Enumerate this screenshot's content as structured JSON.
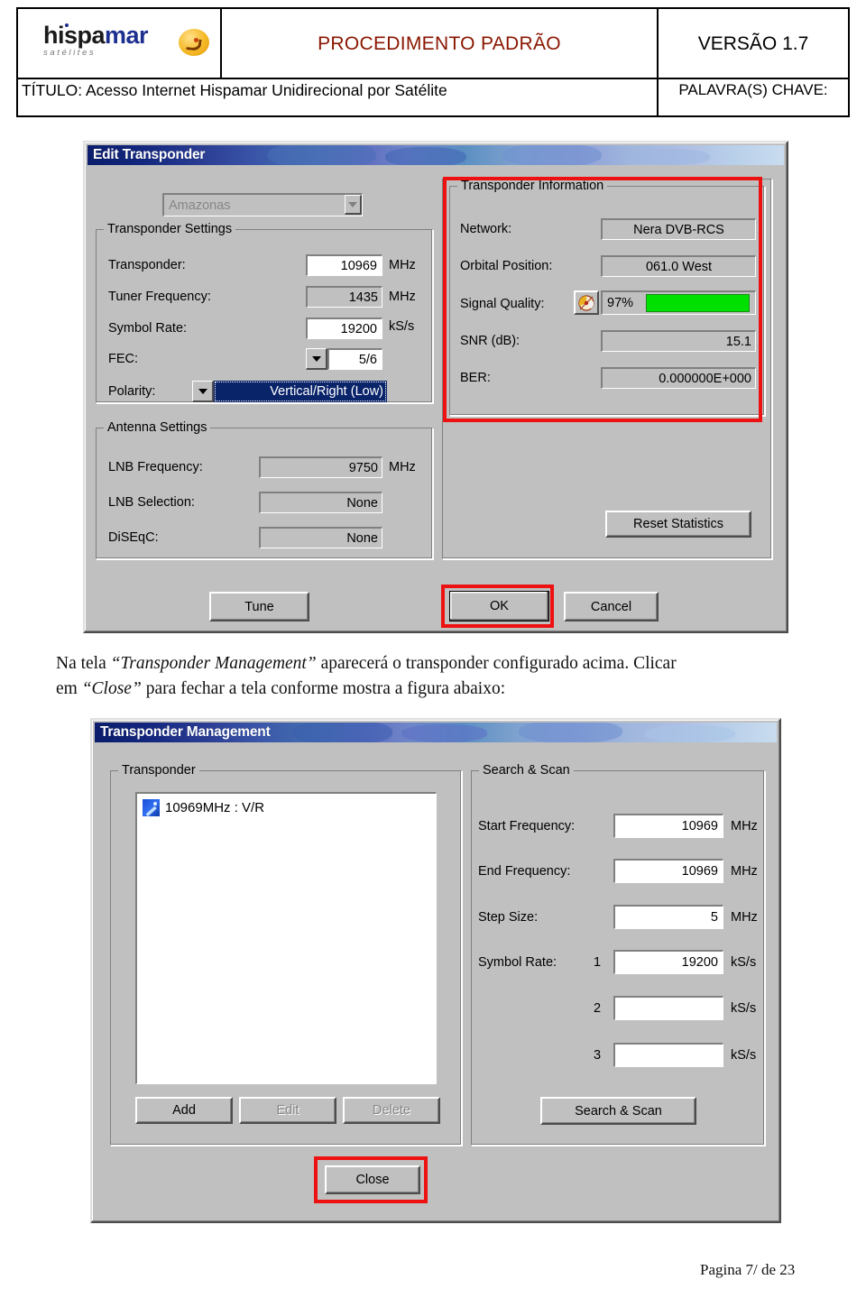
{
  "header": {
    "logo": {
      "brand_part1": "hispa",
      "brand_part2": "mar",
      "tagline": "satélites"
    },
    "doc_type": "PROCEDIMENTO PADRÃO",
    "version": "VERSÃO 1.7",
    "title_label": "TÍTULO: Acesso Internet Hispamar Unidirecional por Satélite",
    "keywords_label": "PALAVRA(S) CHAVE:"
  },
  "edit_transponder": {
    "title": "Edit Transponder",
    "satellite_combo": {
      "value": "Amazonas"
    },
    "transponder_settings": {
      "legend": "Transponder Settings",
      "rows": [
        {
          "label": "Transponder:",
          "value": "10969",
          "unit": "MHz"
        },
        {
          "label": "Tuner Frequency:",
          "value": "1435",
          "unit": "MHz"
        },
        {
          "label": "Symbol Rate:",
          "value": "19200",
          "unit": "kS/s"
        },
        {
          "label": "FEC:",
          "value": "5/6",
          "unit": ""
        },
        {
          "label": "Polarity:",
          "value": "Vertical/Right (Low)",
          "unit": ""
        }
      ]
    },
    "antenna_settings": {
      "legend": "Antenna Settings",
      "rows": [
        {
          "label": "LNB Frequency:",
          "value": "9750",
          "unit": "MHz"
        },
        {
          "label": "LNB Selection:",
          "value": "None",
          "unit": ""
        },
        {
          "label": "DiSEqC:",
          "value": "None",
          "unit": ""
        }
      ]
    },
    "transponder_information": {
      "legend": "Transponder Information",
      "rows": [
        {
          "label": "Network:",
          "value": "Nera DVB-RCS"
        },
        {
          "label": "Orbital Position:",
          "value": "061.0 West"
        },
        {
          "label": "SNR (dB):",
          "value": "15.1"
        },
        {
          "label": "BER:",
          "value": "0.000000E+000"
        }
      ],
      "signal_quality": {
        "label": "Signal Quality:",
        "percent_text": "97%",
        "percent_value": 97,
        "bar_color": "#00e000"
      },
      "reset_button": "Reset Statistics"
    },
    "buttons": {
      "tune": "Tune",
      "ok": "OK",
      "cancel": "Cancel"
    }
  },
  "instruction_paragraph": {
    "line1_pre": "Na tela ",
    "line1_em1": "“Transponder Management”",
    "line1_mid": " aparecerá o transponder configurado acima. Clicar",
    "line2_pre": "em ",
    "line2_em1": "“Close”",
    "line2_post": " para fechar a tela conforme mostra a figura abaixo:"
  },
  "transponder_management": {
    "title": "Transponder Management",
    "transponder_group": {
      "legend": "Transponder",
      "items": [
        {
          "icon": "satellite-icon",
          "text": "10969MHz : V/R"
        }
      ],
      "buttons": [
        {
          "label": "Add",
          "accel": "A",
          "enabled": true
        },
        {
          "label": "Edit",
          "accel": "E",
          "enabled": false
        },
        {
          "label": "Delete",
          "accel": "D",
          "enabled": false
        }
      ]
    },
    "search_scan_group": {
      "legend": "Search & Scan",
      "rows": [
        {
          "label": "Start Frequency:",
          "value": "10969",
          "unit": "MHz"
        },
        {
          "label": "End Frequency:",
          "value": "10969",
          "unit": "MHz"
        },
        {
          "label": "Step Size:",
          "value": "5",
          "unit": "MHz"
        },
        {
          "label": "Symbol Rate:",
          "index": "1",
          "value": "19200",
          "unit": "kS/s"
        },
        {
          "label": "",
          "index": "2",
          "value": "",
          "unit": "kS/s"
        },
        {
          "label": "",
          "index": "3",
          "value": "",
          "unit": "kS/s"
        }
      ],
      "search_button": "Search & Scan"
    },
    "close_button": "Close"
  },
  "footer": {
    "page_number": "Pagina 7/ de 23"
  },
  "colors": {
    "accent_red": "#ee1111",
    "title_red": "#8a1500",
    "dialog_face": "#c0c0c0",
    "signal_green": "#00e000",
    "brand_blue": "#1d2f8f"
  }
}
